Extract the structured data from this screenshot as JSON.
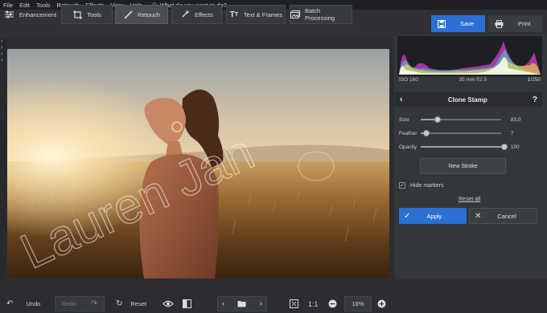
{
  "menu": [
    "File",
    "Edit",
    "Tools",
    "Retouch",
    "Effects",
    "View",
    "Help"
  ],
  "search": {
    "placeholder": "What do you want to do?"
  },
  "tabs": [
    {
      "label": "Enhancement",
      "icon": "sliders-icon"
    },
    {
      "label": "Tools",
      "icon": "crop-icon"
    },
    {
      "label": "Retouch",
      "icon": "brush-icon"
    },
    {
      "label": "Effects",
      "icon": "sparkle-icon"
    },
    {
      "label": "Text & Frames",
      "icon": "text-icon"
    },
    {
      "label": "Batch Processing",
      "icon": "batch-icon"
    }
  ],
  "save_label": "Save",
  "print_label": "Print",
  "watermark": "Lauren Jan",
  "histogram": {
    "iso": "ISO 160",
    "lens": "35 mm f/2.5",
    "shutter": "1/250"
  },
  "clone": {
    "title": "Clone Stamp",
    "help": "?",
    "sliders": [
      {
        "label": "Size",
        "value": "83,0",
        "fraction": 0.2
      },
      {
        "label": "Feather",
        "value": "7",
        "fraction": 0.07
      },
      {
        "label": "Opacity",
        "value": "100",
        "fraction": 1.0
      }
    ],
    "new_stroke": "New Stroke",
    "hide_markers": "Hide markers",
    "reset_all": "Reset all",
    "apply": "Apply",
    "cancel": "Cancel"
  },
  "bottom": {
    "undo": "Undo",
    "redo": "Redo",
    "reset": "Reset",
    "zoom_fit": "1:1",
    "zoom": "16%"
  },
  "colors": {
    "accent": "#2a6fd1",
    "bg": "#2b2d30",
    "panel": "#33363a"
  }
}
